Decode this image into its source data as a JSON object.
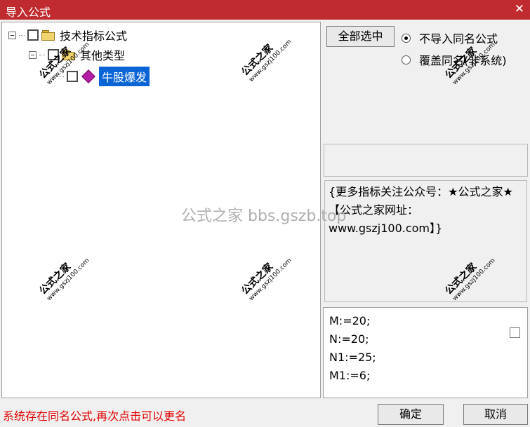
{
  "window": {
    "title": "导入公式",
    "close_glyph": "✕"
  },
  "tree": {
    "root_label": "技术指标公式",
    "group_label": "其他类型",
    "item_label": "牛股爆发"
  },
  "buttons": {
    "select_all": "全部选中",
    "ok": "确定",
    "cancel": "取消"
  },
  "options": {
    "no_import_same_name": "不导入同名公式",
    "overwrite_same_name": "覆盖同名(非系统)",
    "selected": "no_import_same_name"
  },
  "info_text": "{更多指标关注公众号：★公式之家★【公式之家网址：www.gszj100.com】}",
  "code_lines": [
    "M:=20;",
    "N:=20;",
    "N1:=25;",
    "M1:=6;"
  ],
  "status_message": "系统存在同名公式,再次点击可以更名",
  "watermarks": {
    "mark": "公式之家",
    "url": "www.gszj100.com",
    "center": "公式之家 bbs.gszb.top"
  },
  "colors": {
    "titlebar": "#bf2b2f",
    "selection": "#0a64d6",
    "status_text": "#e00000"
  }
}
